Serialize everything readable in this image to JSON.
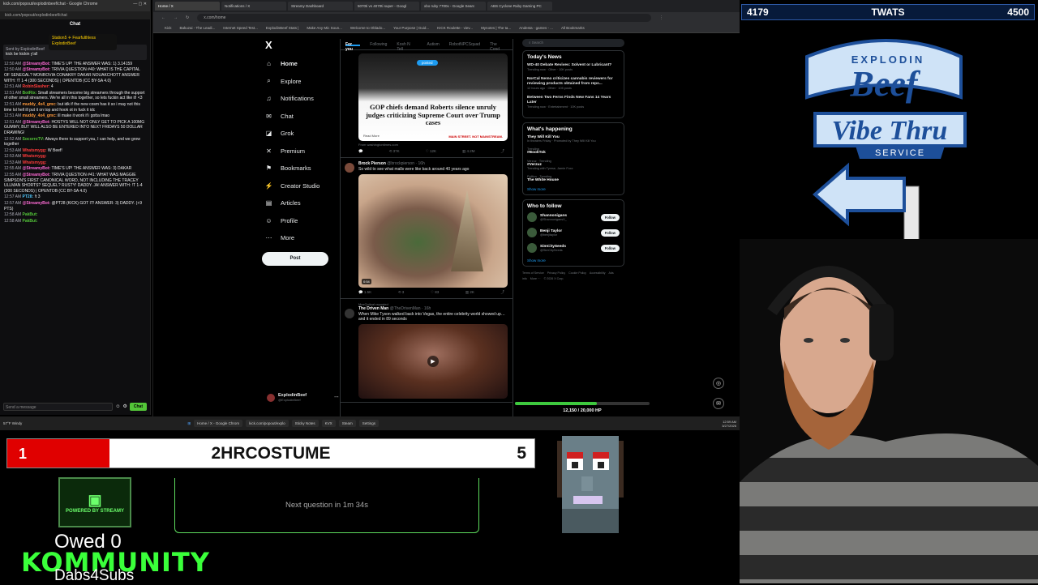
{
  "chat": {
    "window_title": "kick.com/popout/explodinbeef/chat - Google Chrome",
    "url": "kick.com/popout/explodinbeef/chat",
    "heading": "Chat",
    "top_badges": [
      "Station5 ✈ Fearfulthless",
      "ExplodinBeef"
    ],
    "pinned_by": "Sent by ExplodinBeef",
    "pinned_text": "kick be kickin y'all",
    "messages": [
      {
        "time": "12:50 AM",
        "user": "@StreamyBot:",
        "text": "TIME'S UP! THE ANSWER WAS: 1) 3.14159",
        "color": "#ff6bd6"
      },
      {
        "time": "12:50 AM",
        "user": "@StreamyBot:",
        "text": "TRIVIA QUESTION #40: WHAT IS THE CAPITAL OF SENEGAL? MONROVIA CONAKRY DAKAR NOUAKCHOTT ANSWER WITH: !T 1-4 (300 SECONDS) | OPENTDB (CC BY-SA 4.0)",
        "color": "#ff6bd6"
      },
      {
        "time": "12:51 AM",
        "user": "RobinSlasher:",
        "text": "4",
        "color": "#ff3b3b"
      },
      {
        "time": "12:51 AM",
        "user": "BotRix:",
        "text": "Small streamers become big streamers through the support of other small streamers. We're all in this together, so lets fuckin act like it! <3",
        "color": "#53c538"
      },
      {
        "time": "12:51 AM",
        "user": "muddy_4x4_gmc:",
        "text": "but idk if the new cosm has it so i may not this time lol hell ill put it on top and hook ot in fuck it idc",
        "color": "#ff9a3c"
      },
      {
        "time": "12:51 AM",
        "user": "muddy_4x4_gmc:",
        "text": "ill make it work if i gotta lmao",
        "color": "#ff9a3c"
      },
      {
        "time": "12:51 AM",
        "user": "@StreamyBot:",
        "text": "HOSTYS WILL NOT ONLY GET TO PICK A 100MG GUMMY, BUT WILL ALSO BE ENTERED INTO NEXT FRIDAYS 50 DOLLAR DRAWING!",
        "color": "#ff6bd6"
      },
      {
        "time": "12:52 AM",
        "user": "SocorroTV:",
        "text": "Always there to support you, I can help, and we grow together",
        "color": "#53c538"
      },
      {
        "time": "12:53 AM",
        "user": "Whatsmygg:",
        "text": "W Beef!",
        "color": "#ff3b3b"
      },
      {
        "time": "12:53 AM",
        "user": "Whatsmygg:",
        "text": "",
        "color": "#ff3b3b"
      },
      {
        "time": "12:53 AM",
        "user": "Whatsmygg:",
        "text": "",
        "color": "#ff3b3b"
      },
      {
        "time": "12:55 AM",
        "user": "@StreamyBot:",
        "text": "TIME'S UP! THE ANSWER WAS: 3) DAKAR",
        "color": "#ff6bd6"
      },
      {
        "time": "12:55 AM",
        "user": "@StreamyBot:",
        "text": "TRIVIA QUESTION #41: WHAT WAS MAGGIE SIMPSON'S FIRST CANONICAL WORD, NOT INCLUDING THE TRACEY ULLMAN SHORTS? SEQUEL? RUSTY! DADDY. JA! ANSWER WITH: !T 1-4 (300 SECONDS) | OPENTDB (CC BY-SA 4.0)",
        "color": "#ff6bd6"
      },
      {
        "time": "12:57 AM",
        "user": "PT28:",
        "text": "!t 3",
        "color": "#4fc3f7"
      },
      {
        "time": "12:57 AM",
        "user": "@StreamyBot:",
        "text": "@PT28 (KICK) GOT IT! ANSWER: 3) DADDY. (+9 PTS)",
        "color": "#ff6bd6"
      },
      {
        "time": "12:58 AM",
        "user": "PakBut:",
        "text": "",
        "color": "#53c538"
      },
      {
        "time": "12:58 AM",
        "user": "PakBut:",
        "text": "",
        "color": "#53c538"
      }
    ],
    "input_placeholder": "Send a message",
    "send_label": "Chat"
  },
  "browser": {
    "tabs": [
      "Home / X",
      "Notifications / X",
      "Streamy Dashboard",
      "5070ti vs 4070ti super - Googl",
      "xbo ruby 7700x - Google Searc",
      "ABS Cyclone Ruby Gaming PC"
    ],
    "url": "x.com/home",
    "bookmarks": [
      "Kick",
      "Bakuzai - The Leadi...",
      "Internet Speed Test...",
      "ExplodinBeef Stats |",
      "Make Any Mic Soun...",
      "Welcome to Oblado...",
      "Your Purpose | Guid...",
      "KICK Roulette - viev...",
      "Mynotes | The ta...",
      "Andesta - games - ...",
      "All Bookmarks"
    ]
  },
  "x": {
    "logo": "X",
    "nav": [
      {
        "label": "Home",
        "icon": "⌂",
        "icon_name": "home-icon"
      },
      {
        "label": "Explore",
        "icon": "⌕",
        "icon_name": "search-icon"
      },
      {
        "label": "Notifications",
        "icon": "♫",
        "icon_name": "bell-icon"
      },
      {
        "label": "Chat",
        "icon": "✉",
        "icon_name": "mail-icon"
      },
      {
        "label": "Grok",
        "icon": "◪",
        "icon_name": "grok-icon"
      },
      {
        "label": "Premium",
        "icon": "✕",
        "icon_name": "premium-icon"
      },
      {
        "label": "Bookmarks",
        "icon": "⚑",
        "icon_name": "bookmark-icon"
      },
      {
        "label": "Creator Studio",
        "icon": "⚡",
        "icon_name": "creator-studio-icon"
      },
      {
        "label": "Articles",
        "icon": "▤",
        "icon_name": "articles-icon"
      },
      {
        "label": "Profile",
        "icon": "☺",
        "icon_name": "profile-icon"
      },
      {
        "label": "More",
        "icon": "⋯",
        "icon_name": "more-icon"
      }
    ],
    "post_label": "Post",
    "account_name": "ExplodinBeef",
    "account_handle": "@ExplodinBeef",
    "feed_tabs": [
      "For you",
      "Following",
      "Kosh N Tell",
      "Autism",
      "RobotNPCSquad",
      "The Cond"
    ],
    "tweets": [
      {
        "card_pill": "posted",
        "headline": "GOP chiefs demand Roberts silence unruly judges criticizing Supreme Court over Trump cases",
        "read_more": "Read More",
        "brand": "MAIN STREET. NOT MAINSTREAM.",
        "source": "From washingtontimes.com",
        "actions": [
          "",
          "37K",
          "12K",
          "4.2M",
          ""
        ]
      },
      {
        "name": "Brock Pierson",
        "handle": "@brockpierson · 16h",
        "text": "So wild to see what malls were like back around 40 years ago",
        "duration": "0:54",
        "actions": [
          "1.5K",
          "3",
          "83",
          "2K",
          ""
        ]
      },
      {
        "repost": "MezQuitzal reposted",
        "name": "The Driven Man",
        "handle": "@TheDrivenMan · 16h",
        "text": "When Mike Tyson walked back into Vegas, the entire celebrity world showed up… and it ended in 89 seconds",
        "actions": []
      }
    ],
    "search_placeholder": "Search",
    "todays_news_title": "Today's News",
    "news": [
      {
        "title": "WD-40 Debate Revives: Solvent or Lubricant?",
        "meta": "Trending now · Other · 10K posts"
      },
      {
        "title": "NorCal Nemo criticizes cannabis reviewers for reviewing products obtained from reps...",
        "meta": "12 hours ago · Other · 105 posts"
      },
      {
        "title": "Between Two Ferns Finds New Fans 14 Years Later",
        "meta": "Trending now · Entertainment · 10K posts"
      }
    ],
    "happening_title": "What's happening",
    "trends": [
      {
        "cat": "",
        "name": "They Will Kill You",
        "extra": "In theaters Friday · Promoted by They Will Kill You"
      },
      {
        "cat": "Trending",
        "name": "#BookTok",
        "extra": ""
      },
      {
        "cat": "Verzuz · Trending",
        "name": "#Verzuz",
        "extra": "Trending with Tyrese, Jamie Foxx"
      },
      {
        "cat": "Politics · Trending",
        "name": "The White House",
        "extra": ""
      }
    ],
    "show_more": "Show more",
    "follow_title": "Who to follow",
    "follow": [
      {
        "name": "Shannonigans",
        "handle": "@ShannonigansX_"
      },
      {
        "name": "Benji Taylor",
        "handle": "@benjitaylor"
      },
      {
        "name": "SimCitySeeds",
        "handle": "@SimCitySeeds"
      }
    ],
    "follow_label": "Follow",
    "footer": [
      "Terms of Service",
      "Privacy Policy",
      "Cookie Policy",
      "Accessibility",
      "Ads info",
      "More ···",
      "© 2026 X Corp."
    ]
  },
  "hp": {
    "text": "12,150 / 20,000 HP",
    "current": 12150,
    "max": 20000
  },
  "taskbar": {
    "weather": "57°F Windy",
    "tasks": [
      "Home / X - Google Chrom",
      "kick.com/popout/explo",
      "Sticky Notes",
      "KVX",
      "Steam",
      "Settings"
    ],
    "time": "12:59 AM",
    "date": "3/27/2026"
  },
  "score": {
    "left": "4179",
    "mid": "TWATS",
    "right": "4500"
  },
  "logo_text": {
    "top": "EXPLODIN",
    "main": "Beef",
    "script": "Vibe Thru",
    "banner": "SERVICE"
  },
  "question": {
    "number": "1",
    "word": "2HRCOSTUME",
    "right": "5"
  },
  "next_question": "Next question in 1m 34s",
  "streamy_label": "POWERED BY STREAMY",
  "owed": "Owed 0",
  "kommunity": "KOMMUNITY",
  "dabs": "Dabs4Subs"
}
